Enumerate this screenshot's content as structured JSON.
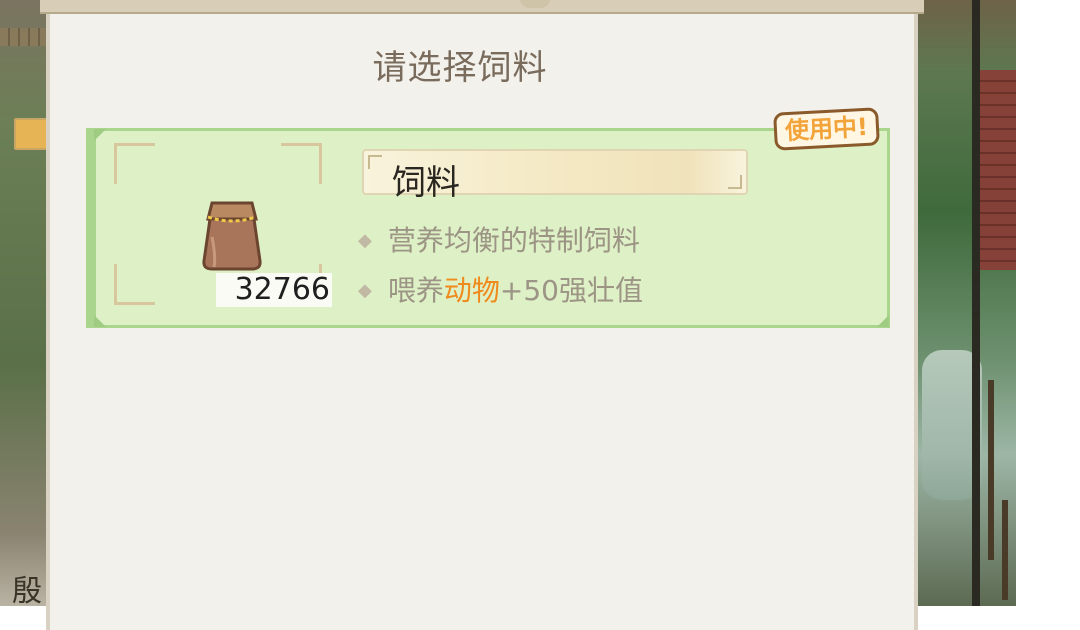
{
  "modal": {
    "title": "请选择饲料"
  },
  "feed_item": {
    "name": "饲料",
    "count": "32766",
    "status_badge": "使用中!",
    "description_line1": "营养均衡的特制饲料",
    "effect_prefix": "喂养",
    "effect_target": "动物",
    "effect_value": "+50强壮值",
    "icon": "feed-bag-icon",
    "colors": {
      "card_bg": "#def0c6",
      "card_border": "#a9d58d",
      "highlight": "#ef8a1c",
      "badge_text": "#f2a43a"
    }
  },
  "background": {
    "left_edge_char": "殷"
  }
}
